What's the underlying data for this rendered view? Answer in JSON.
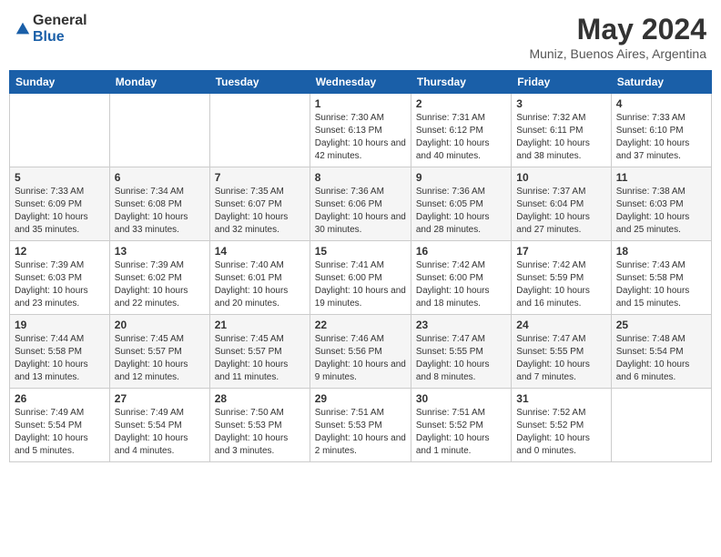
{
  "header": {
    "logo_general": "General",
    "logo_blue": "Blue",
    "month_year": "May 2024",
    "location": "Muniz, Buenos Aires, Argentina"
  },
  "days_of_week": [
    "Sunday",
    "Monday",
    "Tuesday",
    "Wednesday",
    "Thursday",
    "Friday",
    "Saturday"
  ],
  "weeks": [
    [
      {
        "day": "",
        "sunrise": "",
        "sunset": "",
        "daylight": ""
      },
      {
        "day": "",
        "sunrise": "",
        "sunset": "",
        "daylight": ""
      },
      {
        "day": "",
        "sunrise": "",
        "sunset": "",
        "daylight": ""
      },
      {
        "day": "1",
        "sunrise": "Sunrise: 7:30 AM",
        "sunset": "Sunset: 6:13 PM",
        "daylight": "Daylight: 10 hours and 42 minutes."
      },
      {
        "day": "2",
        "sunrise": "Sunrise: 7:31 AM",
        "sunset": "Sunset: 6:12 PM",
        "daylight": "Daylight: 10 hours and 40 minutes."
      },
      {
        "day": "3",
        "sunrise": "Sunrise: 7:32 AM",
        "sunset": "Sunset: 6:11 PM",
        "daylight": "Daylight: 10 hours and 38 minutes."
      },
      {
        "day": "4",
        "sunrise": "Sunrise: 7:33 AM",
        "sunset": "Sunset: 6:10 PM",
        "daylight": "Daylight: 10 hours and 37 minutes."
      }
    ],
    [
      {
        "day": "5",
        "sunrise": "Sunrise: 7:33 AM",
        "sunset": "Sunset: 6:09 PM",
        "daylight": "Daylight: 10 hours and 35 minutes."
      },
      {
        "day": "6",
        "sunrise": "Sunrise: 7:34 AM",
        "sunset": "Sunset: 6:08 PM",
        "daylight": "Daylight: 10 hours and 33 minutes."
      },
      {
        "day": "7",
        "sunrise": "Sunrise: 7:35 AM",
        "sunset": "Sunset: 6:07 PM",
        "daylight": "Daylight: 10 hours and 32 minutes."
      },
      {
        "day": "8",
        "sunrise": "Sunrise: 7:36 AM",
        "sunset": "Sunset: 6:06 PM",
        "daylight": "Daylight: 10 hours and 30 minutes."
      },
      {
        "day": "9",
        "sunrise": "Sunrise: 7:36 AM",
        "sunset": "Sunset: 6:05 PM",
        "daylight": "Daylight: 10 hours and 28 minutes."
      },
      {
        "day": "10",
        "sunrise": "Sunrise: 7:37 AM",
        "sunset": "Sunset: 6:04 PM",
        "daylight": "Daylight: 10 hours and 27 minutes."
      },
      {
        "day": "11",
        "sunrise": "Sunrise: 7:38 AM",
        "sunset": "Sunset: 6:03 PM",
        "daylight": "Daylight: 10 hours and 25 minutes."
      }
    ],
    [
      {
        "day": "12",
        "sunrise": "Sunrise: 7:39 AM",
        "sunset": "Sunset: 6:03 PM",
        "daylight": "Daylight: 10 hours and 23 minutes."
      },
      {
        "day": "13",
        "sunrise": "Sunrise: 7:39 AM",
        "sunset": "Sunset: 6:02 PM",
        "daylight": "Daylight: 10 hours and 22 minutes."
      },
      {
        "day": "14",
        "sunrise": "Sunrise: 7:40 AM",
        "sunset": "Sunset: 6:01 PM",
        "daylight": "Daylight: 10 hours and 20 minutes."
      },
      {
        "day": "15",
        "sunrise": "Sunrise: 7:41 AM",
        "sunset": "Sunset: 6:00 PM",
        "daylight": "Daylight: 10 hours and 19 minutes."
      },
      {
        "day": "16",
        "sunrise": "Sunrise: 7:42 AM",
        "sunset": "Sunset: 6:00 PM",
        "daylight": "Daylight: 10 hours and 18 minutes."
      },
      {
        "day": "17",
        "sunrise": "Sunrise: 7:42 AM",
        "sunset": "Sunset: 5:59 PM",
        "daylight": "Daylight: 10 hours and 16 minutes."
      },
      {
        "day": "18",
        "sunrise": "Sunrise: 7:43 AM",
        "sunset": "Sunset: 5:58 PM",
        "daylight": "Daylight: 10 hours and 15 minutes."
      }
    ],
    [
      {
        "day": "19",
        "sunrise": "Sunrise: 7:44 AM",
        "sunset": "Sunset: 5:58 PM",
        "daylight": "Daylight: 10 hours and 13 minutes."
      },
      {
        "day": "20",
        "sunrise": "Sunrise: 7:45 AM",
        "sunset": "Sunset: 5:57 PM",
        "daylight": "Daylight: 10 hours and 12 minutes."
      },
      {
        "day": "21",
        "sunrise": "Sunrise: 7:45 AM",
        "sunset": "Sunset: 5:57 PM",
        "daylight": "Daylight: 10 hours and 11 minutes."
      },
      {
        "day": "22",
        "sunrise": "Sunrise: 7:46 AM",
        "sunset": "Sunset: 5:56 PM",
        "daylight": "Daylight: 10 hours and 9 minutes."
      },
      {
        "day": "23",
        "sunrise": "Sunrise: 7:47 AM",
        "sunset": "Sunset: 5:55 PM",
        "daylight": "Daylight: 10 hours and 8 minutes."
      },
      {
        "day": "24",
        "sunrise": "Sunrise: 7:47 AM",
        "sunset": "Sunset: 5:55 PM",
        "daylight": "Daylight: 10 hours and 7 minutes."
      },
      {
        "day": "25",
        "sunrise": "Sunrise: 7:48 AM",
        "sunset": "Sunset: 5:54 PM",
        "daylight": "Daylight: 10 hours and 6 minutes."
      }
    ],
    [
      {
        "day": "26",
        "sunrise": "Sunrise: 7:49 AM",
        "sunset": "Sunset: 5:54 PM",
        "daylight": "Daylight: 10 hours and 5 minutes."
      },
      {
        "day": "27",
        "sunrise": "Sunrise: 7:49 AM",
        "sunset": "Sunset: 5:54 PM",
        "daylight": "Daylight: 10 hours and 4 minutes."
      },
      {
        "day": "28",
        "sunrise": "Sunrise: 7:50 AM",
        "sunset": "Sunset: 5:53 PM",
        "daylight": "Daylight: 10 hours and 3 minutes."
      },
      {
        "day": "29",
        "sunrise": "Sunrise: 7:51 AM",
        "sunset": "Sunset: 5:53 PM",
        "daylight": "Daylight: 10 hours and 2 minutes."
      },
      {
        "day": "30",
        "sunrise": "Sunrise: 7:51 AM",
        "sunset": "Sunset: 5:52 PM",
        "daylight": "Daylight: 10 hours and 1 minute."
      },
      {
        "day": "31",
        "sunrise": "Sunrise: 7:52 AM",
        "sunset": "Sunset: 5:52 PM",
        "daylight": "Daylight: 10 hours and 0 minutes."
      },
      {
        "day": "",
        "sunrise": "",
        "sunset": "",
        "daylight": ""
      }
    ]
  ]
}
